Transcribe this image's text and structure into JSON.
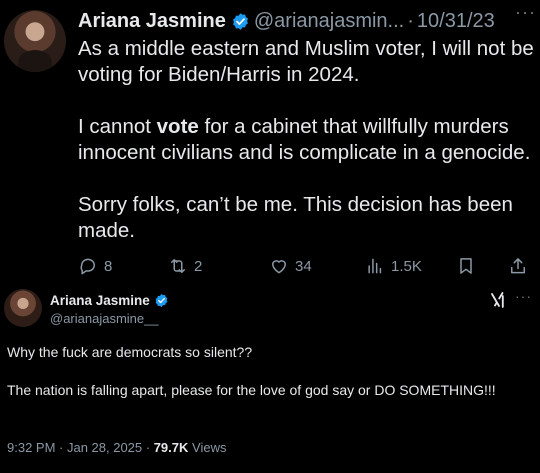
{
  "tweet1": {
    "author_name": "Ariana Jasmine",
    "handle": "@arianajasmin...",
    "separator": "·",
    "date": "10/31/23",
    "more": "···",
    "paragraph1": "As a middle eastern and Muslim voter, I will not be voting for Biden/Harris in 2024.",
    "paragraph2_before": "I cannot ",
    "paragraph2_bold": "vote",
    "paragraph2_after": " for a cabinet that willfully murders innocent civilians and is complicate in a genocide.",
    "paragraph3": "Sorry folks, can’t be me. This decision has been made.",
    "actions": {
      "replies": "8",
      "reposts": "2",
      "likes": "34",
      "views": "1.5K"
    },
    "icons": [
      "reply-icon",
      "repost-icon",
      "like-icon",
      "views-icon",
      "bookmark-icon",
      "share-icon"
    ]
  },
  "tweet2": {
    "author_name": "Ariana Jasmine",
    "handle": "@arianajasmine__",
    "more": "···",
    "line1": "Why the fuck are democrats so silent??",
    "line2": "The nation is falling apart, please for the love of god say or DO SOMETHING!!!",
    "timestamp": "9:32 PM · Jan 28, 2025 · ",
    "views_count": "79.7K",
    "views_label": " Views"
  },
  "colors": {
    "background": "#000000",
    "text": "#e7e9ea",
    "secondary": "#8b98a5",
    "verified": "#1d9bf0"
  }
}
